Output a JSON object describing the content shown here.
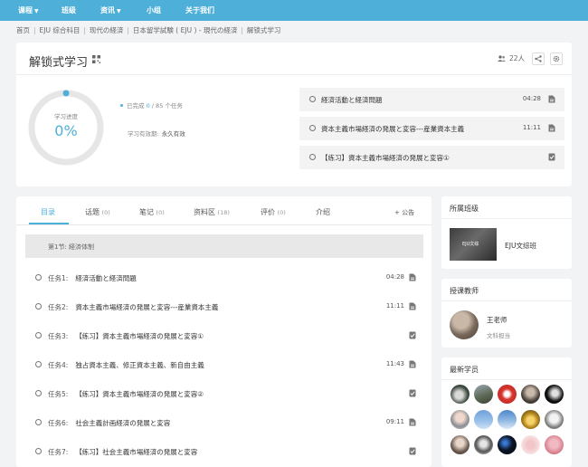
{
  "nav": {
    "items": [
      {
        "label": "课程",
        "caret": true
      },
      {
        "label": "班级",
        "caret": false
      },
      {
        "label": "资讯",
        "caret": true
      },
      {
        "label": "小组",
        "caret": false
      },
      {
        "label": "关于我们",
        "caret": false
      }
    ],
    "caret_glyph": "▼"
  },
  "breadcrumb": [
    "首页",
    "EJU 综合科目",
    "现代の経済",
    "日本留学試験 ( EJU ) - 現代の経済",
    "解锁式学习"
  ],
  "header": {
    "title": "解锁式学习",
    "member_count": "22人",
    "progress": {
      "label": "学习进度",
      "value": "0%",
      "fraction": 0
    },
    "completed_label": "已完成",
    "completed_count": "0",
    "completed_total": "/ 85 个任务",
    "validity_label": "学习有效期:",
    "validity_value": "永久有效",
    "tasks": [
      {
        "title": "経済活動と経済問題",
        "duration": "04:28",
        "icon": "document-icon"
      },
      {
        "title": "資本主義市場経済の発展と変容---産業資本主義",
        "duration": "11:11",
        "icon": "document-icon"
      },
      {
        "title": "【练习】資本主義市場経済の発展と変容①",
        "duration": "",
        "icon": "checkbox-icon"
      }
    ]
  },
  "tabs": [
    {
      "label": "目录",
      "count": "",
      "active": true
    },
    {
      "label": "话题",
      "count": "(0)",
      "active": false
    },
    {
      "label": "笔记",
      "count": "(0)",
      "active": false
    },
    {
      "label": "资料区",
      "count": "(18)",
      "active": false
    },
    {
      "label": "评价",
      "count": "(0)",
      "active": false
    },
    {
      "label": "介绍",
      "count": "",
      "active": false
    }
  ],
  "announce_label": "+ 公告",
  "section": {
    "label": "第1节:  経済体制"
  },
  "tasks": [
    {
      "num": "任务1:",
      "title": "経済活動と経済問題",
      "duration": "04:28",
      "icon": "document-icon"
    },
    {
      "num": "任务2:",
      "title": "資本主義市場経済の発展と変容---産業資本主義",
      "duration": "11:11",
      "icon": "document-icon"
    },
    {
      "num": "任务3:",
      "title": "【练习】資本主義市場経済の発展と変容①",
      "duration": "",
      "icon": "checkbox-icon"
    },
    {
      "num": "任务4:",
      "title": "独占資本主義、修正資本主義、新自由主義",
      "duration": "11:43",
      "icon": "document-icon"
    },
    {
      "num": "任务5:",
      "title": "【练习】資本主義市場経済の発展と変容②",
      "duration": "",
      "icon": "checkbox-icon"
    },
    {
      "num": "任务6:",
      "title": "社会主義計画経済の発展と変容",
      "duration": "09:11",
      "icon": "document-icon"
    },
    {
      "num": "任务7:",
      "title": "【练习】社会主義市場経済の発展と変容",
      "duration": "",
      "icon": "checkbox-icon"
    }
  ],
  "sidebar": {
    "class_panel": {
      "title": "所属班级",
      "thumb_text": "EJU文综",
      "name": "EJU文综班"
    },
    "teacher_panel": {
      "title": "授课教师",
      "name": "王老师",
      "role": "文科担当"
    },
    "students_panel": {
      "title": "最新学员"
    }
  },
  "colors": {
    "accent": "#4eafd8",
    "nav_bg": "#4eafd8",
    "page_bg": "#f2f3f5"
  }
}
